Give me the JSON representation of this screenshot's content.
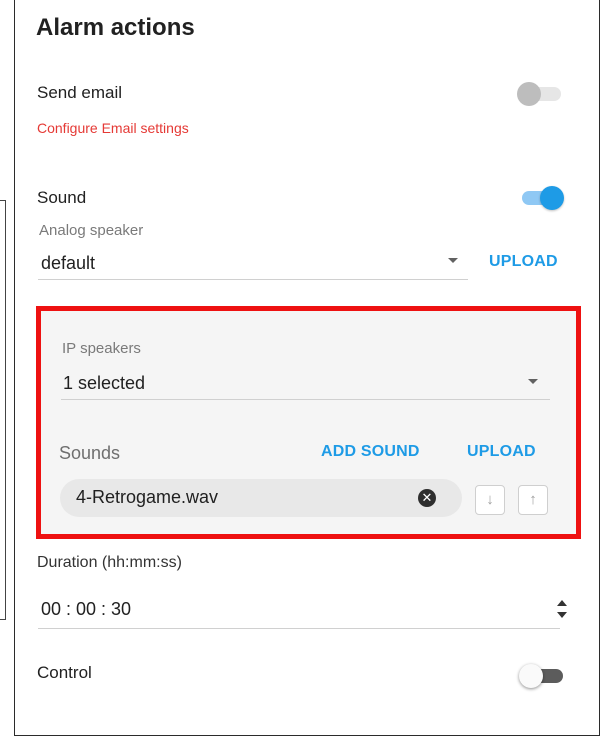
{
  "title": "Alarm actions",
  "email": {
    "label": "Send email",
    "configure_link": "Configure Email settings",
    "toggle_on": false
  },
  "sound": {
    "label": "Sound",
    "toggle_on": true,
    "analog_speaker": {
      "label": "Analog speaker",
      "value": "default"
    },
    "upload_label": "UPLOAD"
  },
  "ip_speakers": {
    "label": "IP speakers",
    "value": "1 selected",
    "sounds_label": "Sounds",
    "add_sound_label": "ADD SOUND",
    "upload_label": "UPLOAD",
    "sound_items": [
      "4-Retrogame.wav"
    ],
    "move_down_icon": "arrow-down-icon",
    "move_up_icon": "arrow-up-icon"
  },
  "duration": {
    "label": "Duration (hh:mm:ss)",
    "value": "00 : 00 : 30"
  },
  "control": {
    "label": "Control",
    "toggle_on": false
  },
  "colors": {
    "accent": "#1e9be6",
    "link_red": "#e53935",
    "highlight_border": "#ee1111"
  }
}
